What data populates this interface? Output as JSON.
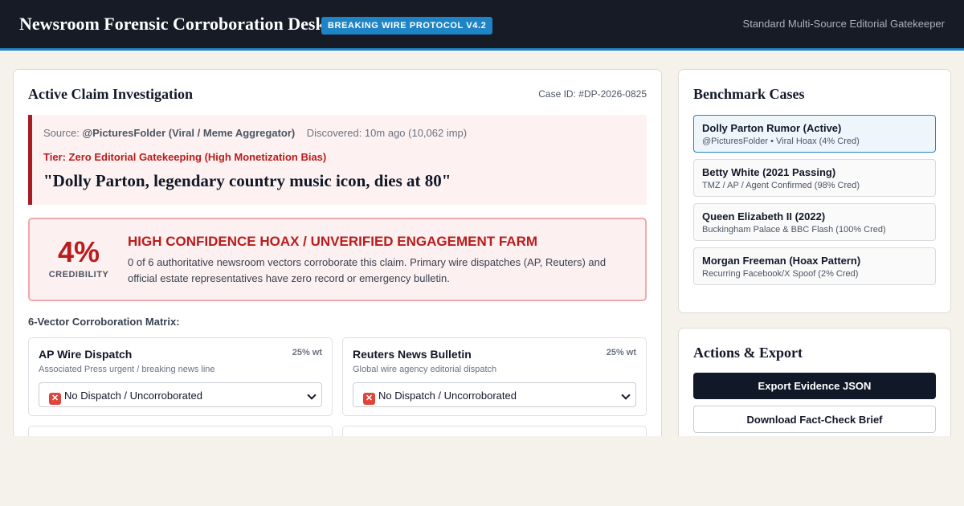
{
  "header": {
    "title": "Newsroom Forensic Corroboration Desk",
    "badge": "BREAKING WIRE PROTOCOL V4.2",
    "subtitle": "Standard Multi-Source Editorial Gatekeeper"
  },
  "investigation": {
    "title": "Active Claim Investigation",
    "case_id": "Case ID: #DP-2026-0825",
    "claim": {
      "source_label": "Source:",
      "source": "@PicturesFolder (Viral / Meme Aggregator)",
      "discovered": "Discovered: 10m ago (10,062 imp)",
      "tier": "Tier: Zero Editorial Gatekeeping (High Monetization Bias)",
      "quote": "\"Dolly Parton, legendary country music icon, dies at 80\""
    },
    "verdict": {
      "score": "4%",
      "score_label": "CREDIBILITY",
      "title": "HIGH CONFIDENCE HOAX / UNVERIFIED ENGAGEMENT FARM",
      "body": "0 of 6 authoritative newsroom vectors corroborate this claim. Primary wire dispatches (AP, Reuters) and official estate representatives have zero record or emergency bulletin."
    },
    "matrix_label": "6-Vector Corroboration Matrix:",
    "vectors": [
      {
        "name": "AP Wire Dispatch",
        "weight": "25% wt",
        "description": "Associated Press urgent / breaking news line",
        "selected": "No Dispatch / Uncorroborated"
      },
      {
        "name": "Reuters News Bulletin",
        "weight": "25% wt",
        "description": "Global wire agency editorial dispatch",
        "selected": "No Dispatch / Uncorroborated"
      }
    ]
  },
  "benchmarks": {
    "title": "Benchmark Cases",
    "items": [
      {
        "name": "Dolly Parton Rumor (Active)",
        "detail": "@PicturesFolder • Viral Hoax (4% Cred)",
        "active": true
      },
      {
        "name": "Betty White (2021 Passing)",
        "detail": "TMZ / AP / Agent Confirmed (98% Cred)",
        "active": false
      },
      {
        "name": "Queen Elizabeth II (2022)",
        "detail": "Buckingham Palace & BBC Flash (100% Cred)",
        "active": false
      },
      {
        "name": "Morgan Freeman (Hoax Pattern)",
        "detail": "Recurring Facebook/X Spoof (2% Cred)",
        "active": false
      }
    ]
  },
  "actions": {
    "title": "Actions & Export",
    "export_json": "Export Evidence JSON",
    "download_brief": "Download Fact-Check Brief"
  },
  "icons": {
    "vector_status": "x-mark-icon",
    "select_caret": "chevron-down-icon"
  },
  "colors": {
    "accent": "#1f84c6",
    "hoax_red": "#b91c1c",
    "header_bg": "#161b26"
  }
}
